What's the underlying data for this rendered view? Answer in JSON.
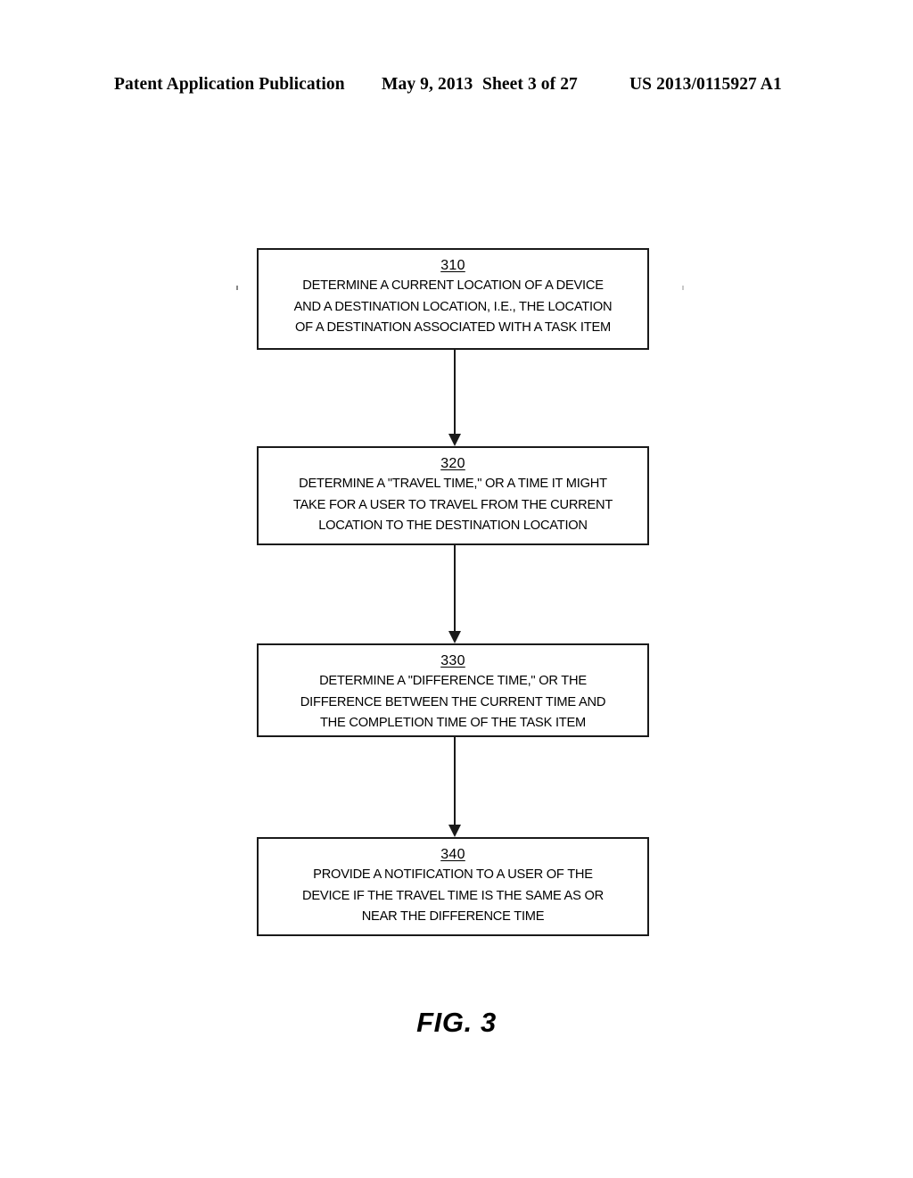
{
  "header": {
    "publication": "Patent Application Publication",
    "date": "May 9, 2013",
    "sheet": "Sheet 3 of 27",
    "patent_number": "US 2013/0115927 A1"
  },
  "figure": {
    "caption": "FIG. 3",
    "type": "flowchart",
    "steps": [
      {
        "ref": "310",
        "lines": [
          "DETERMINE A CURRENT LOCATION OF A DEVICE",
          "AND A DESTINATION LOCATION, I.E., THE LOCATION",
          "OF A DESTINATION ASSOCIATED WITH A TASK ITEM"
        ],
        "text": "DETERMINE A CURRENT LOCATION OF A DEVICE AND A DESTINATION LOCATION, I.E., THE LOCATION OF A DESTINATION ASSOCIATED WITH A TASK ITEM"
      },
      {
        "ref": "320",
        "lines": [
          "DETERMINE A \"TRAVEL TIME,\" OR A TIME IT MIGHT",
          "TAKE FOR A USER TO TRAVEL FROM THE CURRENT",
          "LOCATION TO THE DESTINATION LOCATION"
        ],
        "text": "DETERMINE A \"TRAVEL TIME,\" OR A TIME IT MIGHT TAKE FOR A USER TO TRAVEL FROM THE CURRENT LOCATION TO THE DESTINATION LOCATION"
      },
      {
        "ref": "330",
        "lines": [
          "DETERMINE A \"DIFFERENCE TIME,\" OR THE",
          "DIFFERENCE BETWEEN THE CURRENT TIME AND",
          "THE COMPLETION TIME OF THE TASK ITEM"
        ],
        "text": "DETERMINE A \"DIFFERENCE TIME,\" OR THE DIFFERENCE BETWEEN THE CURRENT TIME AND THE COMPLETION TIME OF THE TASK ITEM"
      },
      {
        "ref": "340",
        "lines": [
          "PROVIDE A NOTIFICATION TO A USER OF THE",
          "DEVICE IF THE TRAVEL TIME IS THE SAME AS OR",
          "NEAR THE DIFFERENCE TIME"
        ],
        "text": "PROVIDE A NOTIFICATION TO A USER OF THE DEVICE IF THE TRAVEL TIME IS THE SAME AS OR NEAR THE DIFFERENCE TIME"
      }
    ],
    "connectors": [
      {
        "from": "310",
        "to": "320",
        "style": "arrow-down"
      },
      {
        "from": "320",
        "to": "330",
        "style": "arrow-down"
      },
      {
        "from": "330",
        "to": "340",
        "style": "arrow-down"
      }
    ]
  },
  "colors": {
    "ink": "#1a1a1a",
    "page": "#ffffff"
  }
}
